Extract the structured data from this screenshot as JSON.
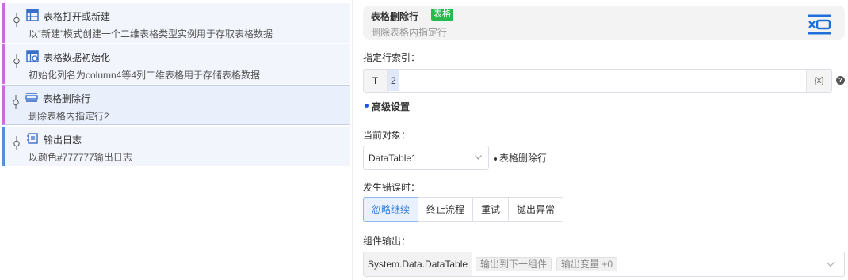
{
  "flow": {
    "steps": [
      {
        "title": "表格打开或新建",
        "desc": "以“新建”模式创建一个二维表格类型实例用于存取表格数据",
        "icon": "table-icon"
      },
      {
        "title": "表格数据初始化",
        "desc": "初始化列名为column4等4列二维表格用于存储表格数据",
        "icon": "table-init-icon"
      },
      {
        "title": "表格删除行",
        "desc": "删除表格内指定行2",
        "icon": "table-delete-row-icon"
      },
      {
        "title": "输出日志",
        "desc": "以颜色#777777输出日志",
        "icon": "log-icon"
      }
    ],
    "selected_index": 2
  },
  "panel": {
    "header": {
      "title": "表格删除行",
      "tag": "表格",
      "desc": "删除表格内指定行",
      "icon": "table-delete-row-icon"
    },
    "row_index": {
      "label": "指定行索引：",
      "prefix": "T",
      "value": "2",
      "suffix": "{x}",
      "help": "?"
    },
    "advanced": {
      "label": "高级设置"
    },
    "current_object": {
      "label": "当前对象：",
      "value": "DataTable1",
      "note": "表格删除行"
    },
    "on_error": {
      "label": "发生错误时：",
      "options": [
        "忽略继续",
        "终止流程",
        "重试",
        "抛出异常"
      ],
      "selected": "忽略继续"
    },
    "output": {
      "label": "组件输出：",
      "type": "System.Data.DataTable",
      "chip_next": "输出到下一组件",
      "chip_var": "输出变量 +0"
    }
  },
  "colors": {
    "accent": "#2a76d6",
    "tag_green": "#25b84a",
    "step_bar": "#c86dd7",
    "log_bar": "#5b8bd6"
  }
}
